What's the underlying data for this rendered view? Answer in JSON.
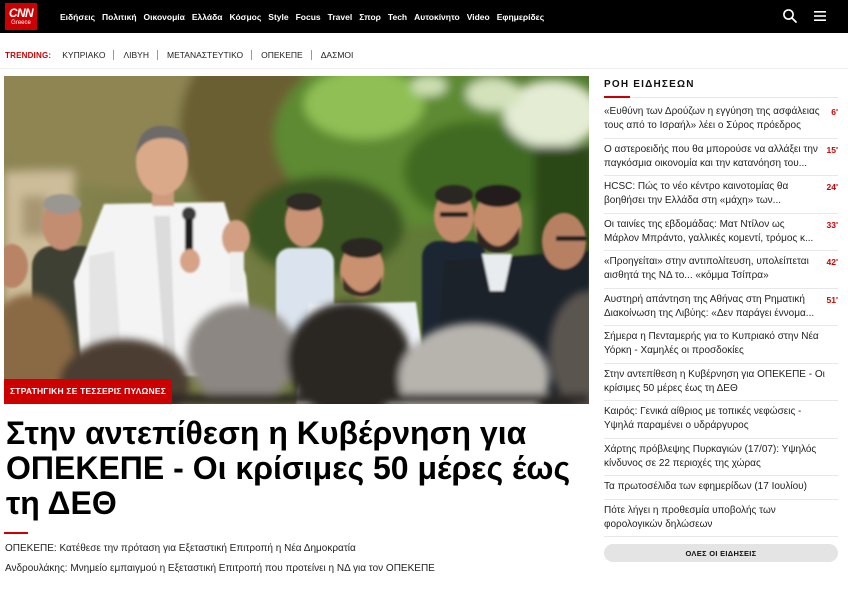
{
  "site": {
    "logo_text": "CNN",
    "logo_sub": "Greece"
  },
  "nav": {
    "items": [
      "Ειδήσεις",
      "Πολιτική",
      "Οικονομία",
      "Ελλάδα",
      "Κόσμος",
      "Style",
      "Focus",
      "Travel",
      "Σπορ",
      "Tech",
      "Αυτοκίνητο",
      "Video",
      "Εφημερίδες"
    ]
  },
  "header_icons": {
    "search": "search-icon",
    "menu": "hamburger-menu-icon"
  },
  "trending": {
    "label": "TRENDING:",
    "items": [
      "ΚΥΠΡΙΑΚΟ",
      "ΛΙΒΥΗ",
      "ΜΕΤΑΝΑΣΤΕΥΤΙΚΟ",
      "ΟΠΕΚΕΠΕ",
      "ΔΑΣΜΟΙ"
    ]
  },
  "hero": {
    "tag": "ΣΤΡΑΤΗΓΙΚΗ ΣΕ ΤΕΣΣΕΡΙΣ ΠΥΛΩΝΕΣ",
    "headline": "Στην αντεπίθεση η Κυβέρνηση για ΟΠΕΚΕΠΕ - Οι κρίσιμες 50 μέρες έως τη ΔΕΘ",
    "related": [
      "ΟΠΕΚΕΠΕ: Κατέθεσε την πρόταση για Εξεταστική Επιτροπή η Νέα Δημοκρατία",
      "Ανδρουλάκης: Μνημείο εμπαιγμού η Εξεταστική Επιτροπή που προτείνει η ΝΔ για τον ΟΠΕΚΕΠΕ"
    ]
  },
  "sidebar": {
    "title": "ΡΟΗ ΕΙΔΗΣΕΩΝ",
    "items": [
      {
        "title": "«Ευθύνη των Δρούζων η εγγύηση της ασφάλειας τους από το Ισραήλ» λέει ο Σύρος πρόεδρος",
        "time": "6'"
      },
      {
        "title": "Ο αστεροειδής που θα μπορούσε να αλλάξει την παγκόσμια οικονομία και την κατανόηση του...",
        "time": "15'"
      },
      {
        "title": "HCSC: Πώς το νέο κέντρο καινοτομίας θα βοηθήσει την Ελλάδα στη «μάχη» των...",
        "time": "24'"
      },
      {
        "title": "Οι ταινίες της εβδομάδας: Ματ Ντίλον ως Μάρλον Μπράντο, γαλλικές κομεντί, τρόμος κ...",
        "time": "33'"
      },
      {
        "title": "«Προηγείται» στην αντιπολίτευση, υπολείπεται αισθητά της ΝΔ το... «κόμμα Τσίπρα»",
        "time": "42'"
      },
      {
        "title": "Αυστηρή απάντηση της Αθήνας στη Ρηματική Διακοίνωση της Λιβύης: «Δεν παράγει έννομα...",
        "time": "51'"
      },
      {
        "title": "Σήμερα η Πενταμερής για το Κυπριακό στην Νέα Υόρκη - Χαμηλές οι προσδοκίες"
      },
      {
        "title": "Στην αντεπίθεση η Κυβέρνηση για ΟΠΕΚΕΠΕ - Οι κρίσιμες 50 μέρες έως τη ΔΕΘ"
      },
      {
        "title": "Καιρός: Γενικά αίθριος με τοπικές νεφώσεις - Υψηλά παραμένει ο υδράργυρος"
      },
      {
        "title": "Χάρτης πρόβλεψης Πυρκαγιών (17/07): Υψηλός κίνδυνος σε 22 περιοχές της χώρας"
      },
      {
        "title": "Τα πρωτοσέλιδα των εφημερίδων (17 Ιουλίου)"
      },
      {
        "title": "Πότε λήγει η προθεσμία υποβολής των φορολογικών δηλώσεων"
      }
    ],
    "button": "ΟΛΕΣ ΟΙ ΕΙΔΗΣΕΙΣ"
  },
  "colors": {
    "accent": "#cc0000",
    "header_bg": "#000000",
    "button_bg": "#e4e4e4"
  }
}
